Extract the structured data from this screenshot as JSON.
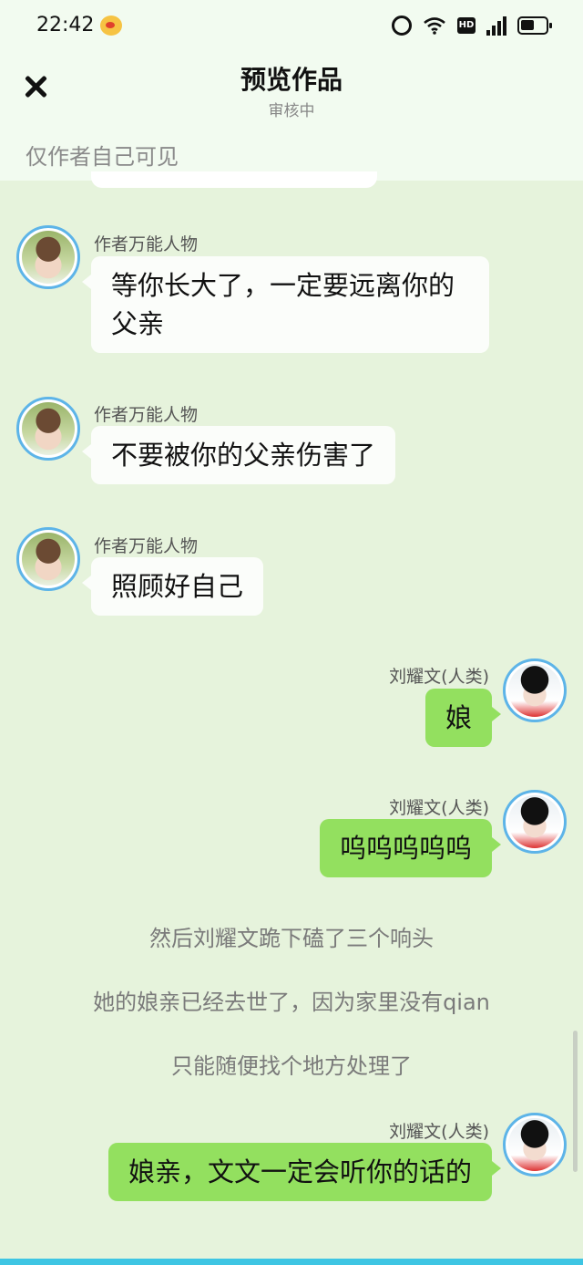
{
  "status_bar": {
    "time": "22:42",
    "network": "4G"
  },
  "header": {
    "title": "预览作品",
    "subtitle": "审核中",
    "visibility_note": "仅作者自己可见",
    "close_icon": "close-icon"
  },
  "messages": [
    {
      "side": "left",
      "name": "作者万能人物",
      "text": "等你长大了，一定要远离你的父亲"
    },
    {
      "side": "left",
      "name": "作者万能人物",
      "text": "不要被你的父亲伤害了"
    },
    {
      "side": "left",
      "name": "作者万能人物",
      "text": "照顾好自己"
    },
    {
      "side": "right",
      "name": "刘耀文(人类)",
      "text": "娘"
    },
    {
      "side": "right",
      "name": "刘耀文(人类)",
      "text": "呜呜呜呜呜"
    }
  ],
  "narration": [
    "然后刘耀文跪下磕了三个响头",
    "她的娘亲已经去世了，因为家里没有qian",
    "只能随便找个地方处理了"
  ],
  "final_message": {
    "side": "right",
    "name": "刘耀文(人类)",
    "text": "娘亲，文文一定会听你的话的"
  },
  "colors": {
    "background": "#e6f3dc",
    "header_bg": "#f2fbf0",
    "right_bubble": "#93e05f",
    "left_bubble": "#fbfdfa",
    "avatar_ring": "#5db4e8"
  }
}
